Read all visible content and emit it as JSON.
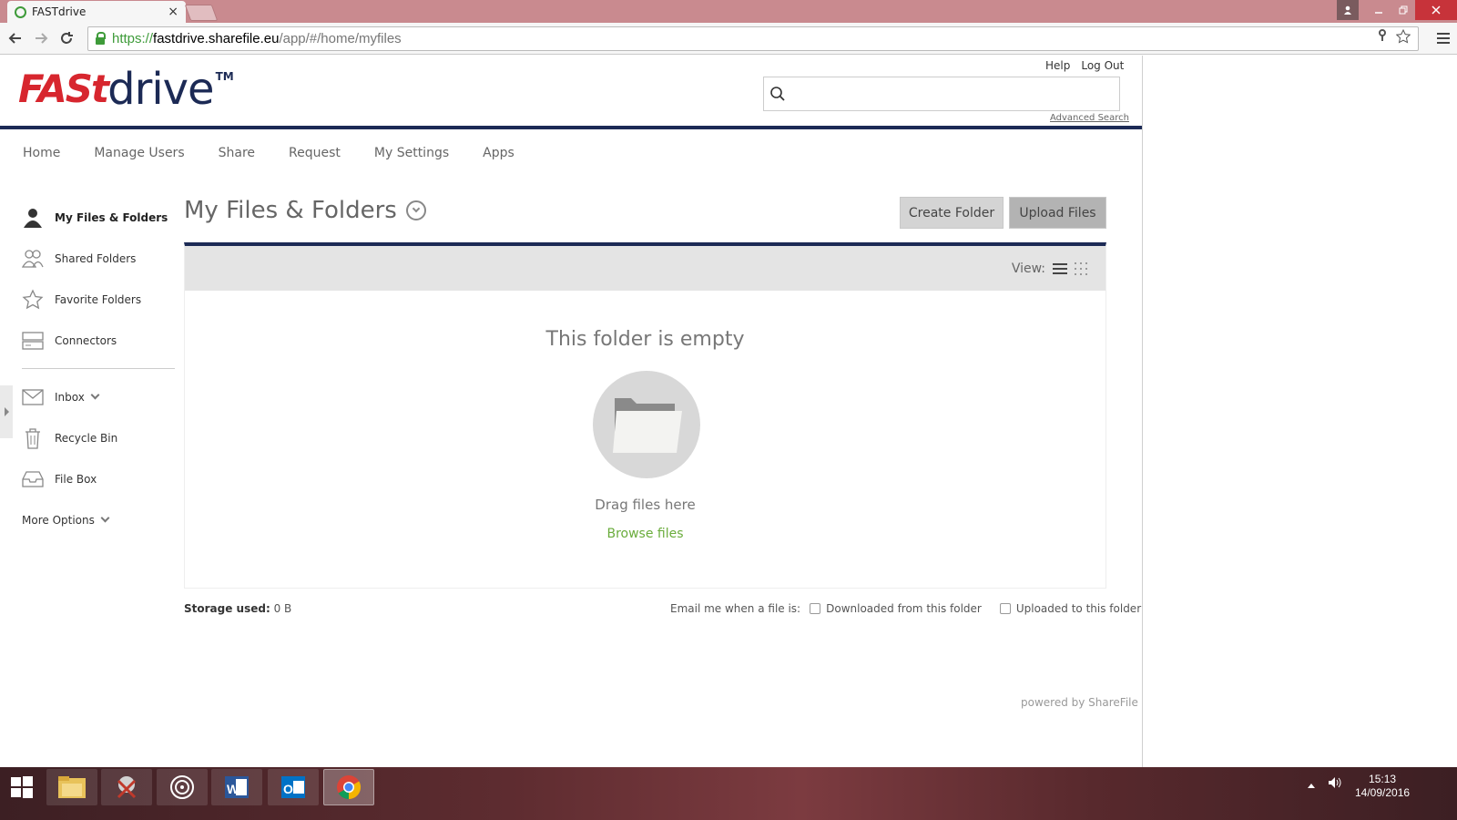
{
  "browser": {
    "tab_title": "FASTdrive",
    "tab_close": "×",
    "url_scheme": "https://",
    "url_host": "fastdrive.sharefile.eu",
    "url_path": "/app/#/home/myfiles"
  },
  "header": {
    "logo_fast": "FASt",
    "logo_drive": "drive",
    "logo_tm": "TM",
    "help_label": "Help",
    "logout_label": "Log Out",
    "search_placeholder": "",
    "advanced_search_label": "Advanced Search"
  },
  "nav": {
    "items": [
      "Home",
      "Manage Users",
      "Share",
      "Request",
      "My Settings",
      "Apps"
    ]
  },
  "sidebar": {
    "items": [
      {
        "label": "My Files & Folders",
        "icon": "user-icon"
      },
      {
        "label": "Shared Folders",
        "icon": "users-icon"
      },
      {
        "label": "Favorite Folders",
        "icon": "star-icon"
      },
      {
        "label": "Connectors",
        "icon": "connector-icon"
      },
      {
        "label": "Inbox",
        "icon": "envelope-icon"
      },
      {
        "label": "Recycle Bin",
        "icon": "trash-icon"
      },
      {
        "label": "File Box",
        "icon": "inbox-tray-icon"
      }
    ],
    "more_options_label": "More Options"
  },
  "main": {
    "title": "My Files & Folders",
    "create_folder_label": "Create Folder",
    "upload_files_label": "Upload Files",
    "view_label": "View:",
    "empty_title": "This folder is empty",
    "drag_label": "Drag files here",
    "browse_label": "Browse files",
    "storage_label": "Storage used:",
    "storage_value": "0 B",
    "email_label": "Email me when a file is:",
    "downloaded_label": "Downloaded from this folder",
    "uploaded_label": "Uploaded to this folder",
    "powered_by": "powered by ShareFile",
    "accent_color": "#1c2a55",
    "link_color": "#6aac3c",
    "brand_red": "#d7262e"
  },
  "taskbar": {
    "time": "15:13",
    "date": "14/09/2016"
  }
}
